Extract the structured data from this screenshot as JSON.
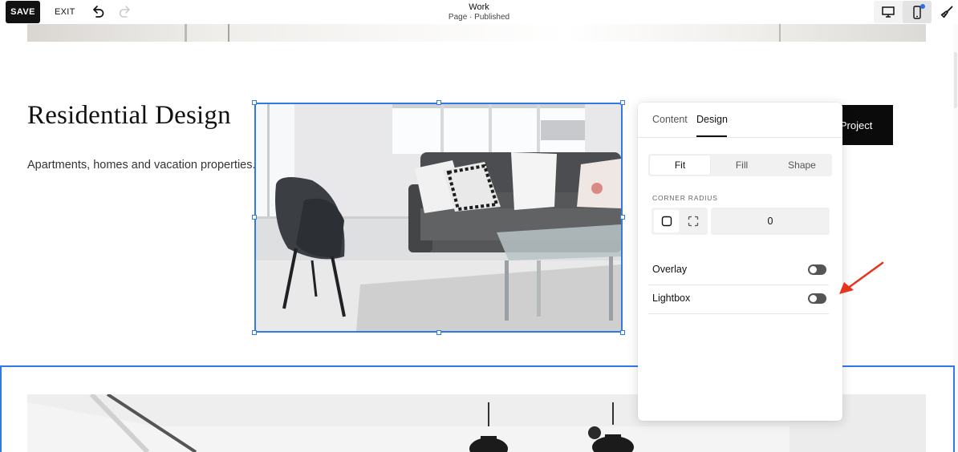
{
  "toolbar": {
    "save_label": "SAVE",
    "exit_label": "EXIT",
    "undo_icon": "undo-icon",
    "redo_icon": "redo-icon",
    "page_title": "Work",
    "page_status": "Page · Published",
    "desktop_icon": "desktop-icon",
    "mobile_icon": "mobile-icon",
    "site_styles_icon": "paintbrush-icon"
  },
  "section": {
    "heading": "Residential Design",
    "description": "Apartments, homes and vacation properties.",
    "button_label": "Start a Project",
    "button_visible_label": "e Project"
  },
  "panel": {
    "tabs": [
      {
        "label": "Content",
        "active": false
      },
      {
        "label": "Design",
        "active": true
      }
    ],
    "fit_options": [
      {
        "label": "Fit",
        "active": true
      },
      {
        "label": "Fill",
        "active": false
      },
      {
        "label": "Shape",
        "active": false
      }
    ],
    "corner_radius_label": "CORNER RADIUS",
    "corner_radius_value": "0",
    "toggles": [
      {
        "label": "Overlay",
        "on": false
      },
      {
        "label": "Lightbox",
        "on": false
      }
    ]
  },
  "colors": {
    "selection_blue": "#2f7ae5",
    "annotation_red": "#e8331f",
    "button_black": "#0b0b0b"
  }
}
